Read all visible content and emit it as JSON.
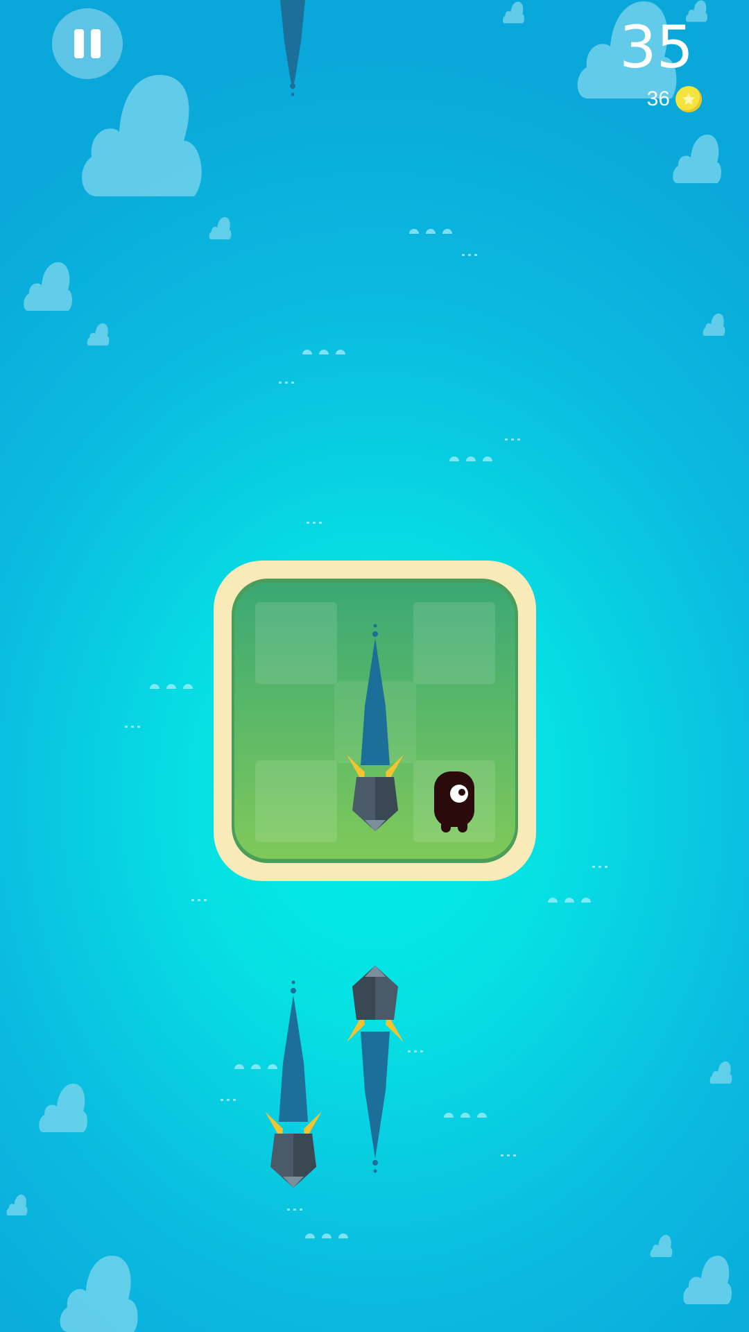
{
  "hud": {
    "score": "35",
    "coins": "36",
    "pause_icon": "pause-icon",
    "coin_icon": "star-coin-icon"
  },
  "colors": {
    "water_light": "#00f0e6",
    "water_dark": "#0aa7da",
    "sand": "#f8ebb9",
    "grass": "#6fc766",
    "shark_body": "#4a5a68",
    "shark_fin": "#f4c430",
    "wake": "#1b6f99",
    "player": "#2a0a0a"
  },
  "island": {
    "grid_cols": 3,
    "grid_rows": 3
  }
}
